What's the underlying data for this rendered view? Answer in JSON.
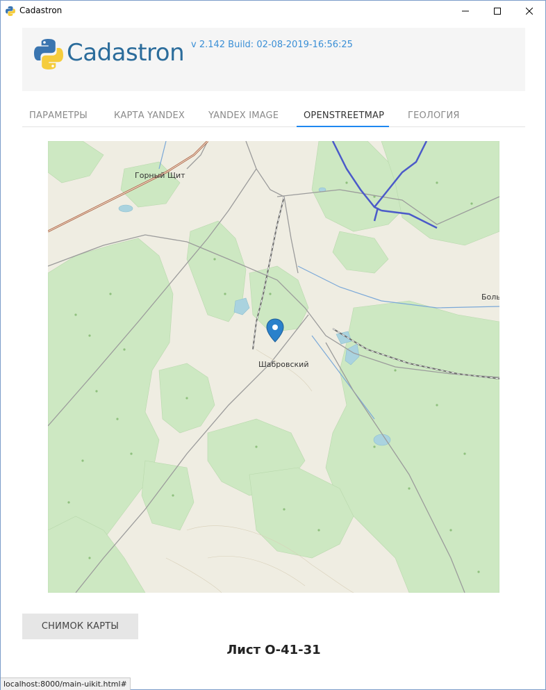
{
  "window": {
    "title": "Cadastron",
    "minimize_icon": "minimize-icon",
    "maximize_icon": "maximize-icon",
    "close_icon": "close-icon"
  },
  "header": {
    "brand": "Cadastron",
    "version": "v 2.142 Build: 02-08-2019-16:56:25",
    "logo_icon": "python-logo-icon"
  },
  "tabs": [
    {
      "label": "ПАРАМЕТРЫ",
      "active": false
    },
    {
      "label": "КАРТА YANDEX",
      "active": false
    },
    {
      "label": "YANDEX IMAGE",
      "active": false
    },
    {
      "label": "OPENSTREETMAP",
      "active": true
    },
    {
      "label": "ГЕОЛОГИЯ",
      "active": false
    }
  ],
  "map": {
    "labels": {
      "town_top": "Горный Щит",
      "town_center": "Шабровский",
      "town_right": "Боль"
    },
    "marker_icon": "map-pin-icon",
    "colors": {
      "forest": "#cde8c2",
      "background": "#efede2",
      "water": "#aad3df",
      "road": "#888888",
      "highway": "#4b5ac9",
      "rail": "#6e6e6e"
    }
  },
  "actions": {
    "snapshot_button": "СНИМОК КАРТЫ"
  },
  "sheet_label": "Лист О-41-31",
  "statusbar": {
    "url": "localhost:8000/main-uikit.html#"
  }
}
